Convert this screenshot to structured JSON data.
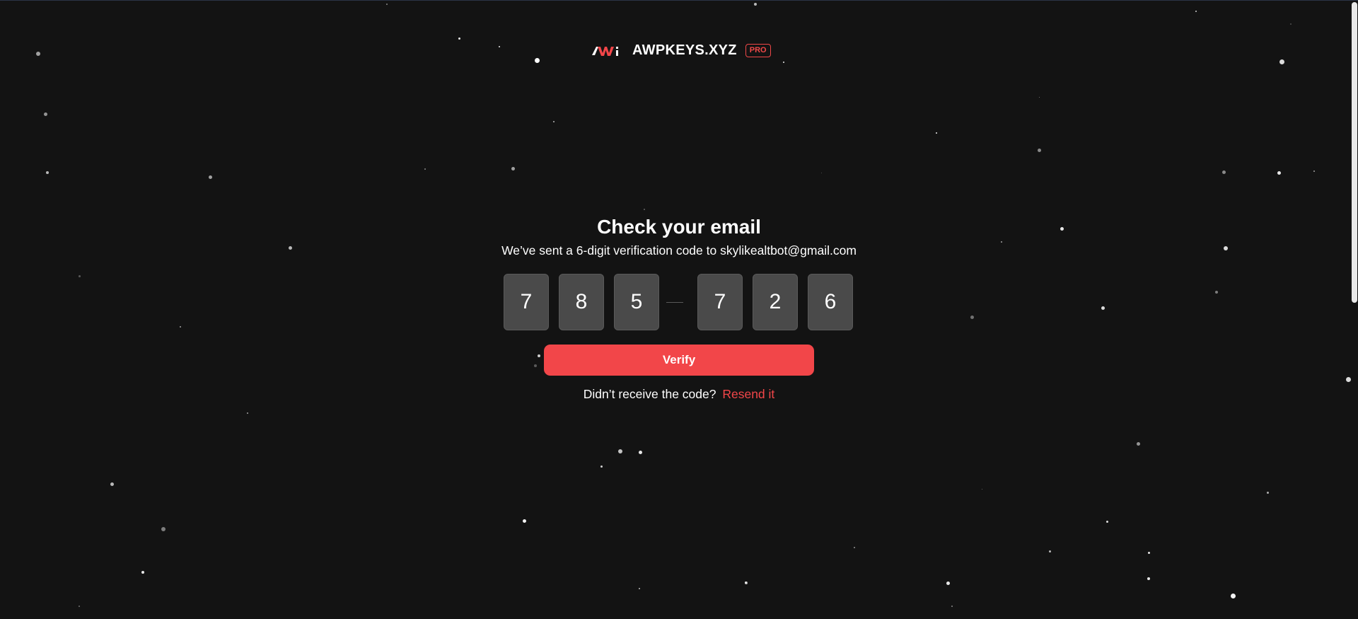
{
  "brand": {
    "logo_icon": "awp-logo-icon",
    "name": "AWPKEYS.XYZ",
    "badge": "PRO",
    "accent_color": "#f24649"
  },
  "verification": {
    "title": "Check your email",
    "subtitle": "We’ve sent a 6-digit verification code to skylikealtbot@gmail.com",
    "code_digits": [
      "7",
      "8",
      "5",
      "7",
      "2",
      "6"
    ],
    "verify_label": "Verify",
    "resend_prompt": "Didn’t receive the code?",
    "resend_label": "Resend it"
  },
  "colors": {
    "background": "#131313",
    "code_box": "#4a4a4a",
    "accent": "#f24649"
  }
}
